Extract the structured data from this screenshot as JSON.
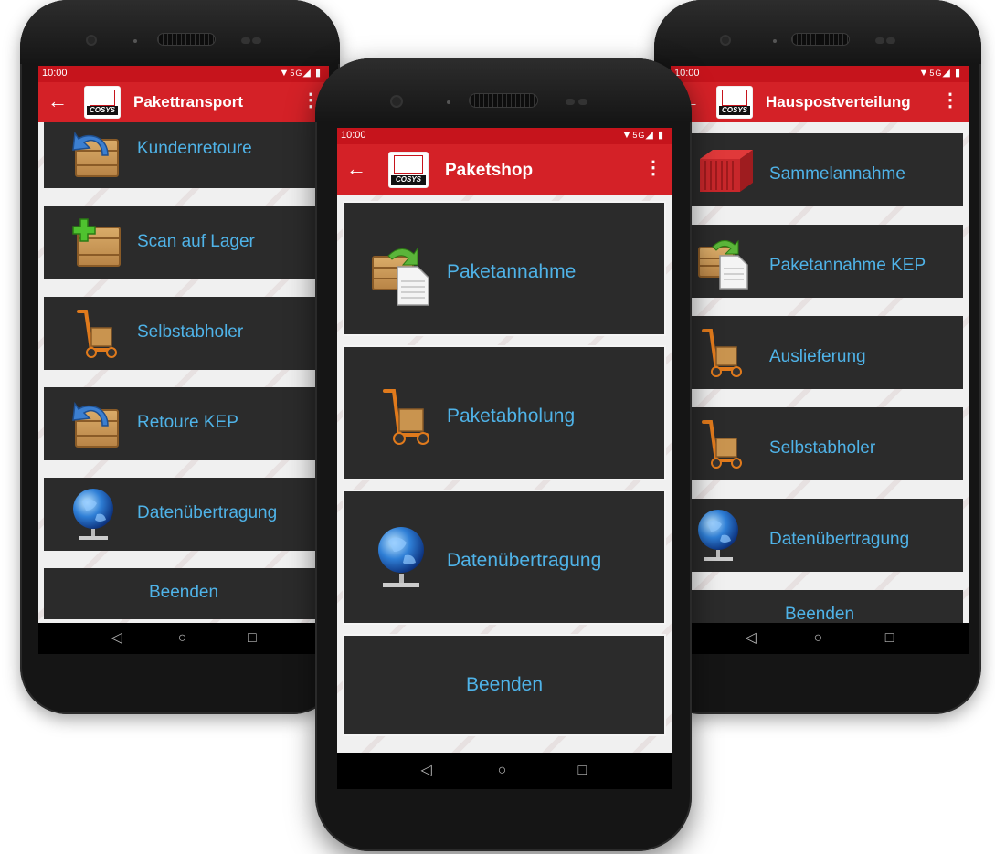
{
  "status": {
    "time": "10:00",
    "network": "5G"
  },
  "phones": {
    "left": {
      "title": "Pakettransport",
      "tiles": [
        {
          "label": "Kundenretoure",
          "icon": "return-box-icon"
        },
        {
          "label": "Scan auf Lager",
          "icon": "add-box-icon"
        },
        {
          "label": "Selbstabholer",
          "icon": "handtruck-icon"
        },
        {
          "label": "Retoure KEP",
          "icon": "return-box-icon"
        },
        {
          "label": "Datenübertragung",
          "icon": "globe-network-icon"
        },
        {
          "label": "Beenden",
          "icon": ""
        }
      ]
    },
    "center": {
      "title": "Paketshop",
      "tiles": [
        {
          "label": "Paketannahme",
          "icon": "package-document-icon"
        },
        {
          "label": "Paketabholung",
          "icon": "handtruck-icon"
        },
        {
          "label": "Datenübertragung",
          "icon": "globe-network-icon"
        },
        {
          "label": "Beenden",
          "icon": ""
        }
      ]
    },
    "right": {
      "title": "Hauspostverteilung",
      "tiles": [
        {
          "label": "Sammelannahme",
          "icon": "container-icon"
        },
        {
          "label": "Paketannahme KEP",
          "icon": "package-document-icon"
        },
        {
          "label": "Auslieferung",
          "icon": "handtruck-icon"
        },
        {
          "label": "Selbstabholer",
          "icon": "handtruck-icon"
        },
        {
          "label": "Datenübertragung",
          "icon": "globe-network-icon"
        },
        {
          "label": "Beenden",
          "icon": ""
        }
      ]
    }
  },
  "logo_text": "COSYS",
  "colors": {
    "appbar": "#d42127",
    "tile": "#2b2b2b",
    "label": "#4fb3e8"
  }
}
